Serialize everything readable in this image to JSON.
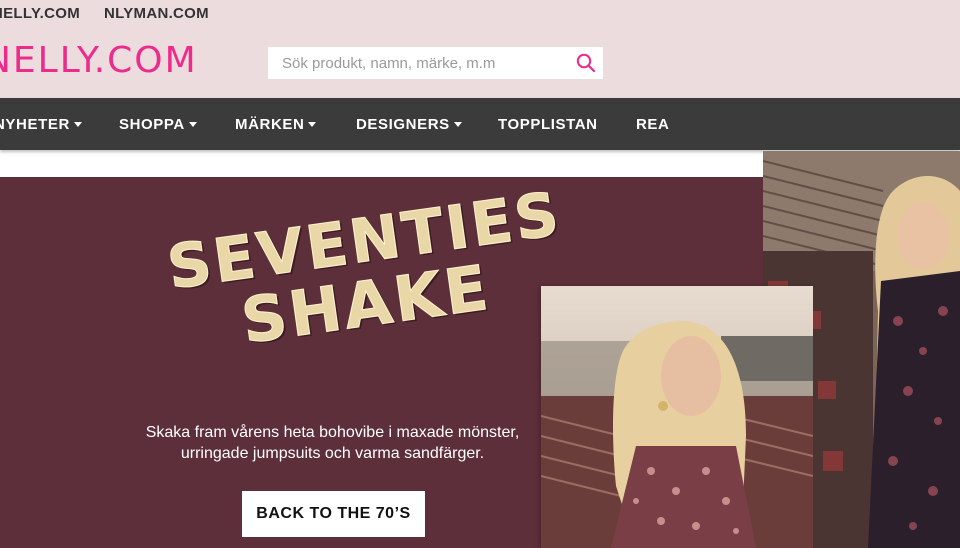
{
  "top_links": [
    {
      "label": "NELLY.COM"
    },
    {
      "label": "NLYMAN.COM"
    }
  ],
  "logo": {
    "text": "NELLY.COM"
  },
  "search": {
    "placeholder": "Sök produkt, namn, märke, m.m",
    "value": ""
  },
  "nav": {
    "items": [
      {
        "label": "NYHETER",
        "has_dropdown": true
      },
      {
        "label": "SHOPPA",
        "has_dropdown": true
      },
      {
        "label": "MÄRKEN",
        "has_dropdown": true
      },
      {
        "label": "DESIGNERS",
        "has_dropdown": true
      },
      {
        "label": "TOPPLISTAN",
        "has_dropdown": false
      },
      {
        "label": "REA",
        "has_dropdown": false
      }
    ]
  },
  "hero": {
    "title_line_1": "SEVENTIES",
    "title_line_2": "SHAKE",
    "description_line_1": "Skaka fram vårens heta bohovibe i maxade mönster,",
    "description_line_2": "urringade jumpsuits och varma sandfärger.",
    "cta_label": "BACK TO THE 70’S"
  },
  "colors": {
    "topbar_bg": "#ecdcdd",
    "brand_pink": "#ec2b8c",
    "nav_bg": "#3b3b3b",
    "hero_bg": "#5d2f3a",
    "hero_title": "#e9d7a8"
  },
  "icons": {
    "search": "search-icon",
    "dropdown": "caret-down-icon"
  }
}
